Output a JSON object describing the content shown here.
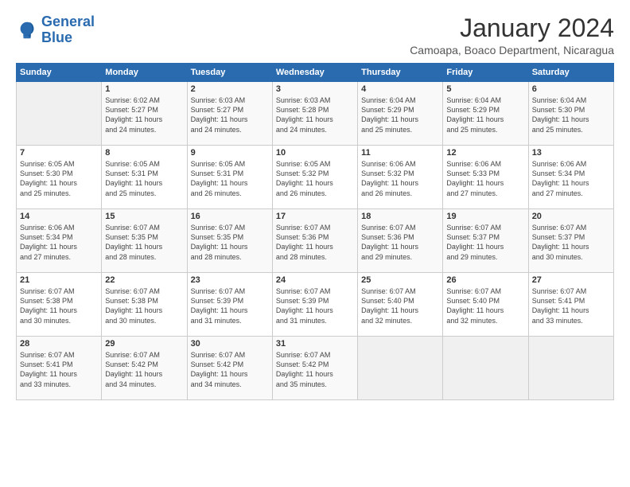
{
  "logo": {
    "line1": "General",
    "line2": "Blue"
  },
  "title": "January 2024",
  "location": "Camoapa, Boaco Department, Nicaragua",
  "header": {
    "days": [
      "Sunday",
      "Monday",
      "Tuesday",
      "Wednesday",
      "Thursday",
      "Friday",
      "Saturday"
    ]
  },
  "weeks": [
    [
      {
        "day": "",
        "info": ""
      },
      {
        "day": "1",
        "info": "Sunrise: 6:02 AM\nSunset: 5:27 PM\nDaylight: 11 hours\nand 24 minutes."
      },
      {
        "day": "2",
        "info": "Sunrise: 6:03 AM\nSunset: 5:27 PM\nDaylight: 11 hours\nand 24 minutes."
      },
      {
        "day": "3",
        "info": "Sunrise: 6:03 AM\nSunset: 5:28 PM\nDaylight: 11 hours\nand 24 minutes."
      },
      {
        "day": "4",
        "info": "Sunrise: 6:04 AM\nSunset: 5:29 PM\nDaylight: 11 hours\nand 25 minutes."
      },
      {
        "day": "5",
        "info": "Sunrise: 6:04 AM\nSunset: 5:29 PM\nDaylight: 11 hours\nand 25 minutes."
      },
      {
        "day": "6",
        "info": "Sunrise: 6:04 AM\nSunset: 5:30 PM\nDaylight: 11 hours\nand 25 minutes."
      }
    ],
    [
      {
        "day": "7",
        "info": "Sunrise: 6:05 AM\nSunset: 5:30 PM\nDaylight: 11 hours\nand 25 minutes."
      },
      {
        "day": "8",
        "info": "Sunrise: 6:05 AM\nSunset: 5:31 PM\nDaylight: 11 hours\nand 25 minutes."
      },
      {
        "day": "9",
        "info": "Sunrise: 6:05 AM\nSunset: 5:31 PM\nDaylight: 11 hours\nand 26 minutes."
      },
      {
        "day": "10",
        "info": "Sunrise: 6:05 AM\nSunset: 5:32 PM\nDaylight: 11 hours\nand 26 minutes."
      },
      {
        "day": "11",
        "info": "Sunrise: 6:06 AM\nSunset: 5:32 PM\nDaylight: 11 hours\nand 26 minutes."
      },
      {
        "day": "12",
        "info": "Sunrise: 6:06 AM\nSunset: 5:33 PM\nDaylight: 11 hours\nand 27 minutes."
      },
      {
        "day": "13",
        "info": "Sunrise: 6:06 AM\nSunset: 5:34 PM\nDaylight: 11 hours\nand 27 minutes."
      }
    ],
    [
      {
        "day": "14",
        "info": "Sunrise: 6:06 AM\nSunset: 5:34 PM\nDaylight: 11 hours\nand 27 minutes."
      },
      {
        "day": "15",
        "info": "Sunrise: 6:07 AM\nSunset: 5:35 PM\nDaylight: 11 hours\nand 28 minutes."
      },
      {
        "day": "16",
        "info": "Sunrise: 6:07 AM\nSunset: 5:35 PM\nDaylight: 11 hours\nand 28 minutes."
      },
      {
        "day": "17",
        "info": "Sunrise: 6:07 AM\nSunset: 5:36 PM\nDaylight: 11 hours\nand 28 minutes."
      },
      {
        "day": "18",
        "info": "Sunrise: 6:07 AM\nSunset: 5:36 PM\nDaylight: 11 hours\nand 29 minutes."
      },
      {
        "day": "19",
        "info": "Sunrise: 6:07 AM\nSunset: 5:37 PM\nDaylight: 11 hours\nand 29 minutes."
      },
      {
        "day": "20",
        "info": "Sunrise: 6:07 AM\nSunset: 5:37 PM\nDaylight: 11 hours\nand 30 minutes."
      }
    ],
    [
      {
        "day": "21",
        "info": "Sunrise: 6:07 AM\nSunset: 5:38 PM\nDaylight: 11 hours\nand 30 minutes."
      },
      {
        "day": "22",
        "info": "Sunrise: 6:07 AM\nSunset: 5:38 PM\nDaylight: 11 hours\nand 30 minutes."
      },
      {
        "day": "23",
        "info": "Sunrise: 6:07 AM\nSunset: 5:39 PM\nDaylight: 11 hours\nand 31 minutes."
      },
      {
        "day": "24",
        "info": "Sunrise: 6:07 AM\nSunset: 5:39 PM\nDaylight: 11 hours\nand 31 minutes."
      },
      {
        "day": "25",
        "info": "Sunrise: 6:07 AM\nSunset: 5:40 PM\nDaylight: 11 hours\nand 32 minutes."
      },
      {
        "day": "26",
        "info": "Sunrise: 6:07 AM\nSunset: 5:40 PM\nDaylight: 11 hours\nand 32 minutes."
      },
      {
        "day": "27",
        "info": "Sunrise: 6:07 AM\nSunset: 5:41 PM\nDaylight: 11 hours\nand 33 minutes."
      }
    ],
    [
      {
        "day": "28",
        "info": "Sunrise: 6:07 AM\nSunset: 5:41 PM\nDaylight: 11 hours\nand 33 minutes."
      },
      {
        "day": "29",
        "info": "Sunrise: 6:07 AM\nSunset: 5:42 PM\nDaylight: 11 hours\nand 34 minutes."
      },
      {
        "day": "30",
        "info": "Sunrise: 6:07 AM\nSunset: 5:42 PM\nDaylight: 11 hours\nand 34 minutes."
      },
      {
        "day": "31",
        "info": "Sunrise: 6:07 AM\nSunset: 5:42 PM\nDaylight: 11 hours\nand 35 minutes."
      },
      {
        "day": "",
        "info": ""
      },
      {
        "day": "",
        "info": ""
      },
      {
        "day": "",
        "info": ""
      }
    ]
  ]
}
